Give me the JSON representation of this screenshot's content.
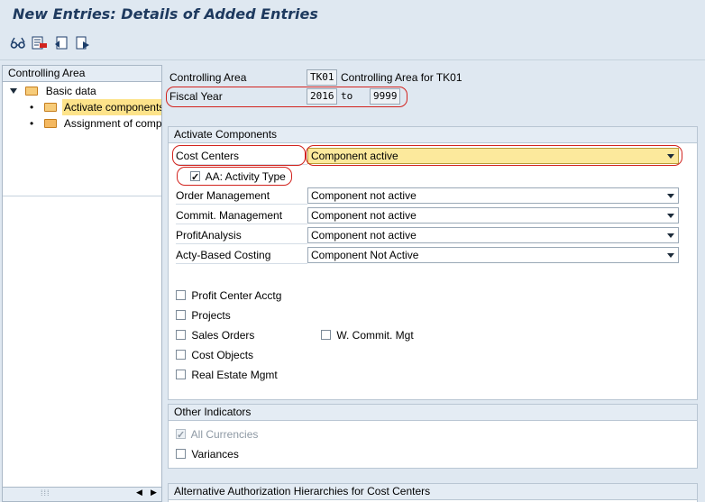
{
  "window": {
    "title": "New Entries: Details of Added Entries"
  },
  "toolbar": {
    "buttons": [
      {
        "icon": "edit-glasses-icon"
      },
      {
        "icon": "delete-entry-icon"
      },
      {
        "icon": "undo-change-icon"
      },
      {
        "icon": "copy-as-icon"
      }
    ]
  },
  "tree": {
    "header": "Controlling Area",
    "items": [
      {
        "label": "Basic data",
        "level": 0,
        "expanded": true
      },
      {
        "label": "Activate components",
        "level": 1,
        "selected": true
      },
      {
        "label": "Assignment of company codes",
        "level": 1
      }
    ]
  },
  "header_fields": {
    "controlling_area_label": "Controlling Area",
    "controlling_area_value": "TK01",
    "controlling_area_desc": "Controlling Area for TK01",
    "fiscal_year_label": "Fiscal Year",
    "fiscal_year_from": "2016",
    "to_label": "to",
    "fiscal_year_to": "9999"
  },
  "activate_components": {
    "header": "Activate Components",
    "rows": [
      {
        "label": "Cost Centers",
        "value": "Component active",
        "active": true
      },
      {
        "label": "Order Management",
        "value": "Component not active"
      },
      {
        "label": "Commit. Management",
        "value": "Component not active"
      },
      {
        "label": "ProfitAnalysis",
        "value": "Component not active"
      },
      {
        "label": "Acty-Based Costing",
        "value": "Component Not Active"
      }
    ],
    "activity_type": {
      "label": "AA: Activity Type",
      "checked": true
    },
    "checkboxes": {
      "profit_center": "Profit Center Acctg",
      "projects": "Projects",
      "sales_orders": "Sales Orders",
      "w_commit": "W. Commit. Mgt",
      "cost_objects": "Cost Objects",
      "real_estate": "Real Estate Mgmt"
    }
  },
  "other_indicators": {
    "header": "Other Indicators",
    "all_currencies": {
      "label": "All Currencies",
      "checked": true,
      "disabled": true
    },
    "variances": {
      "label": "Variances",
      "checked": false
    }
  },
  "alt_auth": {
    "header": "Alternative Authorization Hierarchies for Cost Centers"
  },
  "colors": {
    "highlight": "#fce99c",
    "annotation": "#d2231e",
    "title": "#1e3a5f"
  }
}
